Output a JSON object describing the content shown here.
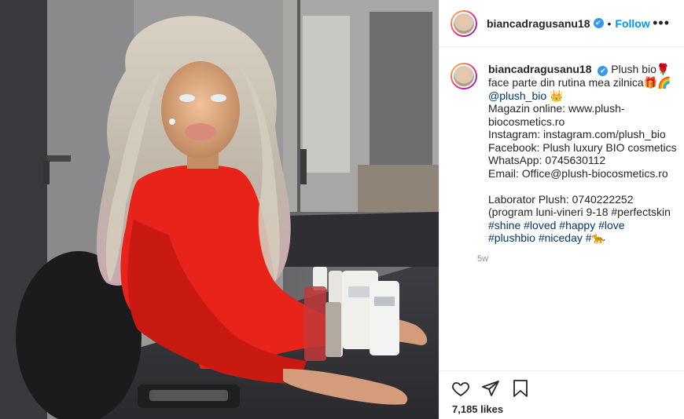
{
  "post": {
    "username": "biancadragusanu18",
    "verified_mark": "✔",
    "dot": "•",
    "follow_label": "Follow",
    "more_label": "•••",
    "caption_lines": [
      "Plush bio🌹",
      "face parte din rutina mea zilnica🎁🌈",
      "@plush_bio 👑",
      "Magazin online: www.plush-",
      "biocosmetics.ro",
      "Instagram: instagram.com/plush_bio",
      "Facebook: Plush luxury BIO cosmetics",
      "WhatsApp: 0745630112",
      "Email: Office@plush-biocosmetics.ro",
      "",
      "Laborator Plush: 0740222252",
      "(program luni-vineri 9-18 #perfectskin",
      "#shine #loved #happy #love",
      "#plushbio #niceday #🐆"
    ],
    "time_ago": "5w",
    "likes": "7,185 likes"
  },
  "icons": {
    "like": "heart-icon",
    "share": "share-icon",
    "save": "bookmark-icon",
    "more": "more-icon",
    "verified": "verified-badge-icon"
  },
  "colors": {
    "accent": "#0095f6",
    "verified": "#3897f0",
    "text": "#262626",
    "muted": "#8e8e8e",
    "sweater": "#e8231a"
  }
}
